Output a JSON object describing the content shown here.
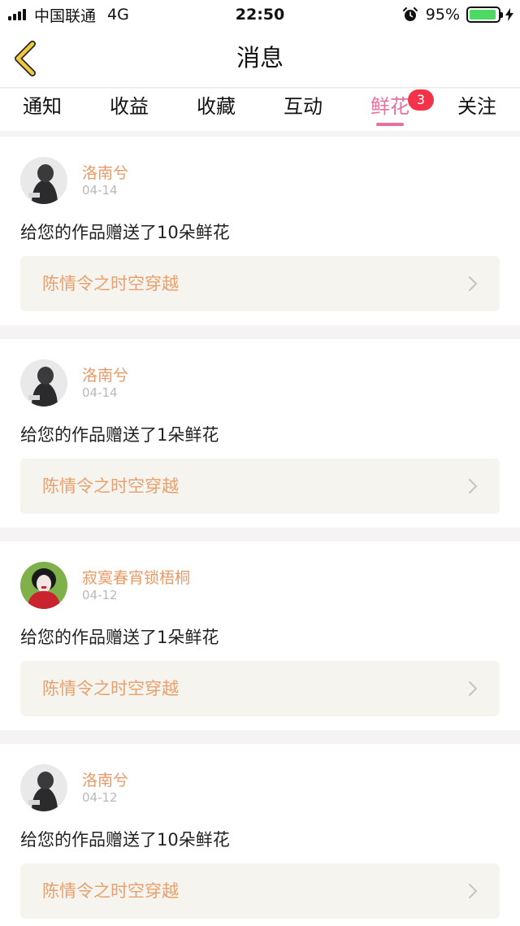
{
  "status_bar": {
    "carrier": "中国联通",
    "network": "4G",
    "time": "22:50",
    "battery": "95%",
    "battery_level": 0.95
  },
  "nav": {
    "title": "消息",
    "back_icon": "back-chevron-icon"
  },
  "tabs": [
    {
      "label": "通知",
      "active": false
    },
    {
      "label": "收益",
      "active": false
    },
    {
      "label": "收藏",
      "active": false
    },
    {
      "label": "互动",
      "active": false
    },
    {
      "label": "鲜花",
      "active": true,
      "badge": "3"
    },
    {
      "label": "关注",
      "active": false
    }
  ],
  "messages": [
    {
      "user": "洛南兮",
      "date": "04-14",
      "text": "给您的作品赠送了10朵鲜花",
      "work": "陈情令之时空穿越",
      "avatar": "avatar-dark-figure"
    },
    {
      "user": "洛南兮",
      "date": "04-14",
      "text": "给您的作品赠送了1朵鲜花",
      "work": "陈情令之时空穿越",
      "avatar": "avatar-dark-figure"
    },
    {
      "user": "寂寞春宵锁梧桐",
      "date": "04-12",
      "text": "给您的作品赠送了1朵鲜花",
      "work": "陈情令之时空穿越",
      "avatar": "avatar-red-opera"
    },
    {
      "user": "洛南兮",
      "date": "04-12",
      "text": "给您的作品赠送了10朵鲜花",
      "work": "陈情令之时空穿越",
      "avatar": "avatar-dark-figure"
    }
  ],
  "colors": {
    "accent": "#e8709c",
    "username": "#e79a66",
    "work_title": "#e8a06e",
    "badge": "#f2334a",
    "back_icon": "#f0c93c"
  }
}
